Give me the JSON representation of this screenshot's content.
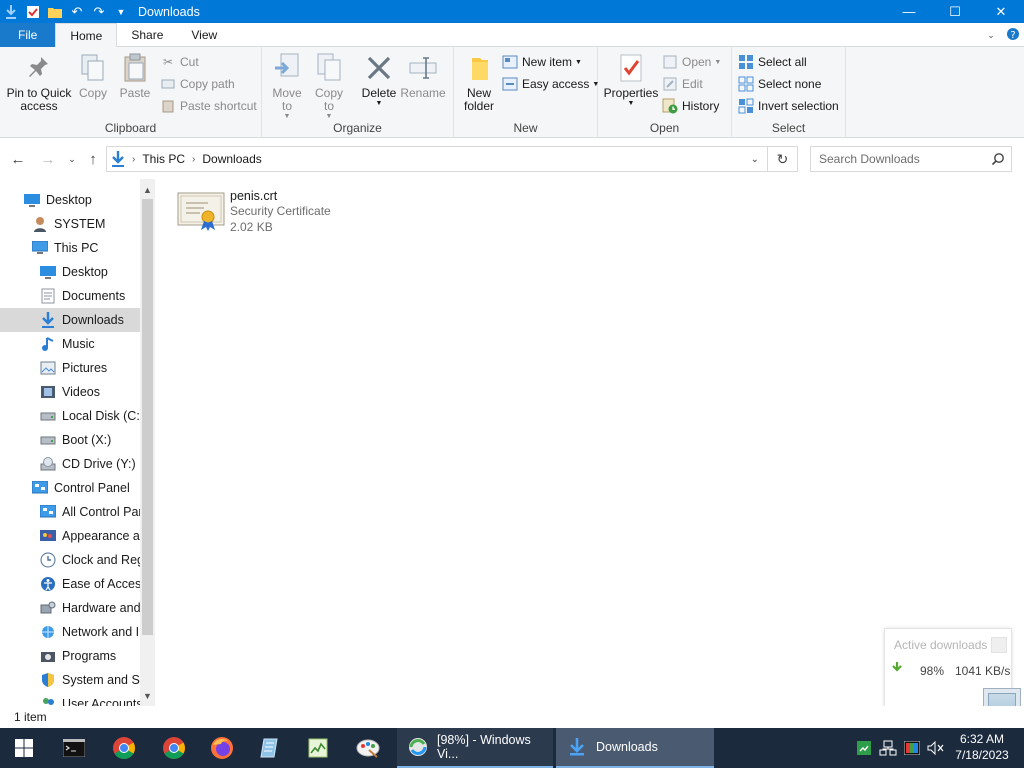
{
  "window": {
    "title": "Downloads",
    "controls": {
      "minimize": "—",
      "maximize": "☐",
      "close": "✕"
    }
  },
  "ribbon_tabs": [
    "File",
    "Home",
    "Share",
    "View"
  ],
  "ribbon": {
    "clipboard": {
      "label": "Clipboard",
      "pin": "Pin to Quick access",
      "copy": "Copy",
      "paste": "Paste",
      "cut": "Cut",
      "copy_path": "Copy path",
      "paste_shortcut": "Paste shortcut"
    },
    "organize": {
      "label": "Organize",
      "move_to": "Move to",
      "copy_to": "Copy to",
      "delete": "Delete",
      "rename": "Rename"
    },
    "new": {
      "label": "New",
      "new_folder": "New folder",
      "new_item": "New item",
      "easy_access": "Easy access"
    },
    "open": {
      "label": "Open",
      "properties": "Properties",
      "open": "Open",
      "edit": "Edit",
      "history": "History"
    },
    "select": {
      "label": "Select",
      "select_all": "Select all",
      "select_none": "Select none",
      "invert": "Invert selection"
    }
  },
  "address": {
    "crumbs": [
      "This PC",
      "Downloads"
    ],
    "search_placeholder": "Search Downloads"
  },
  "nav_pane": [
    {
      "label": "Desktop",
      "icon": "desktop-icon",
      "indent": 0
    },
    {
      "label": "SYSTEM",
      "icon": "user-icon",
      "indent": 1
    },
    {
      "label": "This PC",
      "icon": "computer-icon",
      "indent": 1
    },
    {
      "label": "Desktop",
      "icon": "desktop-icon",
      "indent": 2
    },
    {
      "label": "Documents",
      "icon": "documents-icon",
      "indent": 2
    },
    {
      "label": "Downloads",
      "icon": "downloads-icon",
      "indent": 2,
      "selected": true
    },
    {
      "label": "Music",
      "icon": "music-icon",
      "indent": 2
    },
    {
      "label": "Pictures",
      "icon": "pictures-icon",
      "indent": 2
    },
    {
      "label": "Videos",
      "icon": "videos-icon",
      "indent": 2
    },
    {
      "label": "Local Disk (C:)",
      "icon": "drive-icon",
      "indent": 2
    },
    {
      "label": "Boot (X:)",
      "icon": "drive-icon",
      "indent": 2
    },
    {
      "label": "CD Drive (Y:) H",
      "icon": "cd-drive-icon",
      "indent": 2
    },
    {
      "label": "Control Panel",
      "icon": "control-panel-icon",
      "indent": 1
    },
    {
      "label": "All Control Par",
      "icon": "control-panel-icon",
      "indent": 2
    },
    {
      "label": "Appearance an",
      "icon": "appearance-icon",
      "indent": 2
    },
    {
      "label": "Clock and Regi",
      "icon": "clock-icon",
      "indent": 2
    },
    {
      "label": "Ease of Access",
      "icon": "ease-of-access-icon",
      "indent": 2
    },
    {
      "label": "Hardware and",
      "icon": "hardware-icon",
      "indent": 2
    },
    {
      "label": "Network and Ir",
      "icon": "network-icon",
      "indent": 2
    },
    {
      "label": "Programs",
      "icon": "programs-icon",
      "indent": 2
    },
    {
      "label": "System and Se",
      "icon": "system-security-icon",
      "indent": 2
    },
    {
      "label": "User Accounts",
      "icon": "user-accounts-icon",
      "indent": 2
    }
  ],
  "file": {
    "name": "penis.crt",
    "type": "Security Certificate",
    "size": "2.02 KB"
  },
  "status": {
    "item_count": "1 item"
  },
  "downloads_popup": {
    "title": "Active downloads",
    "percent": "98%",
    "speed": "1041 KB/s"
  },
  "taskbar": {
    "tasks": [
      {
        "label": "[98%] - Windows Vi...",
        "icon": "download-manager-icon"
      },
      {
        "label": "Downloads",
        "icon": "downloads-icon"
      }
    ],
    "clock": {
      "time": "6:32 AM",
      "date": "7/18/2023"
    }
  },
  "colors": {
    "accent": "#0078d7",
    "taskbar": "#1c2a3d",
    "selected": "#d9d9d9"
  }
}
